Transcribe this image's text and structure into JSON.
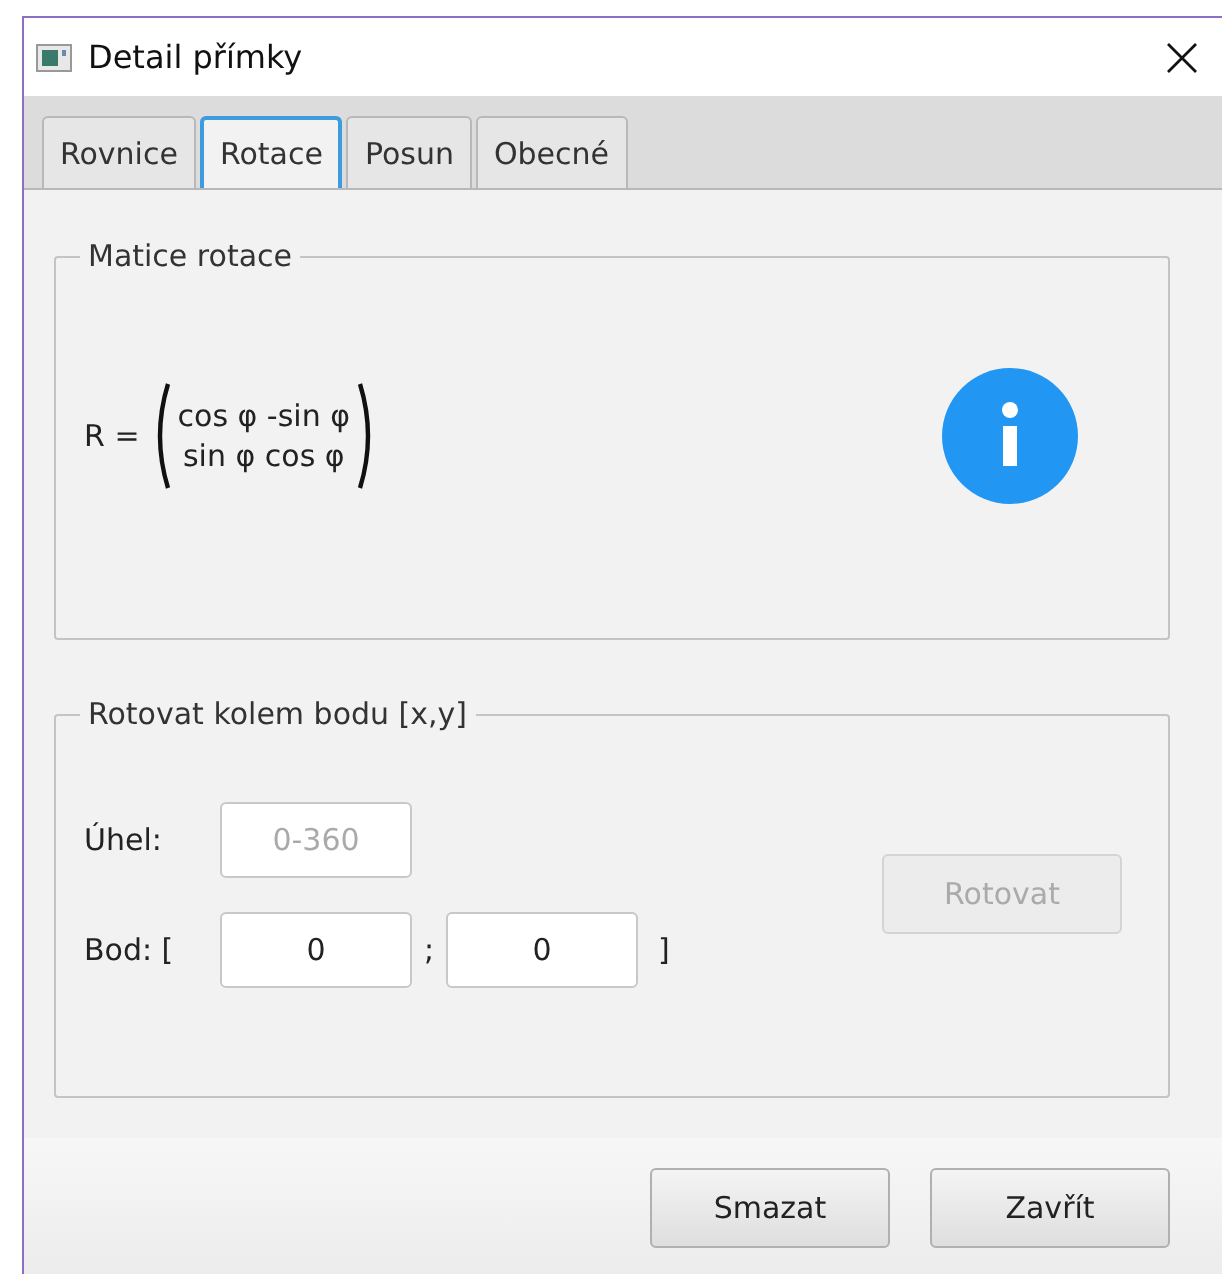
{
  "window": {
    "title": "Detail přímky"
  },
  "tabs": [
    {
      "label": "Rovnice",
      "selected": false
    },
    {
      "label": "Rotace",
      "selected": true
    },
    {
      "label": "Posun",
      "selected": false
    },
    {
      "label": "Obecné",
      "selected": false
    }
  ],
  "matrix_group": {
    "title": "Matice rotace",
    "lhs": "R =",
    "rows": [
      "cos φ -sin φ",
      "sin φ cos φ"
    ]
  },
  "rotate_group": {
    "title": "Rotovat kolem bodu [x,y]",
    "angle_label": "Úhel:",
    "angle": {
      "placeholder": "0-360"
    },
    "point_label": "Bod: [",
    "x": {
      "value": "0"
    },
    "separator": ";",
    "y": {
      "value": "0"
    },
    "closing": "]",
    "rotate_button": {
      "label": "Rotovat",
      "disabled": true
    }
  },
  "buttons": [
    {
      "label": "Smazat"
    },
    {
      "label": "Zavřít"
    }
  ]
}
